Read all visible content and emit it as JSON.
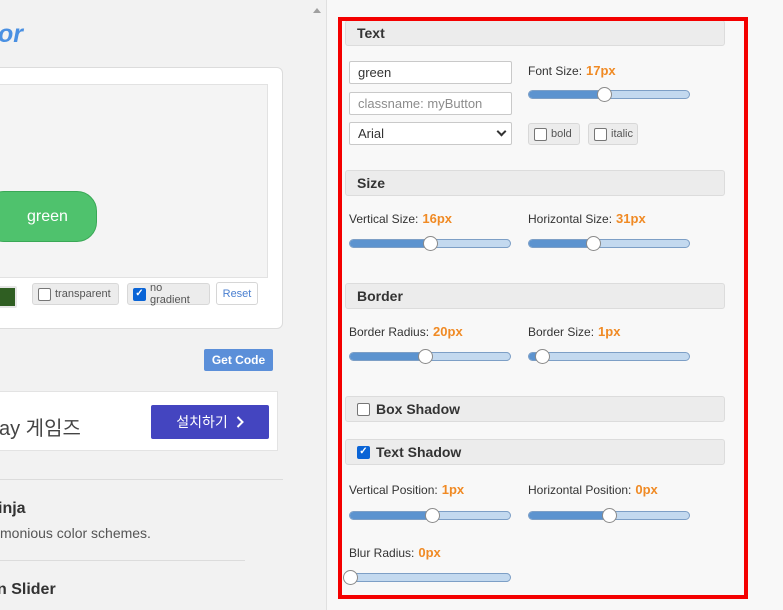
{
  "left": {
    "title": "or",
    "preview_text": "green",
    "swatch_color": "#2f5e22",
    "transparent_label": "transparent",
    "transparent_checked": false,
    "no_gradient_label": "no gradient",
    "no_gradient_checked": true,
    "reset_label": "Reset",
    "get_code_label": "Get Code",
    "ad_text": "ay 게임즈",
    "ad_button_label": "설치하기",
    "link1_title": "inja",
    "link1_desc": "monious color schemes.",
    "link2_title": "n Slider"
  },
  "text_section": {
    "title": "Text",
    "text_value": "green",
    "classname_placeholder": "classname: myButton",
    "font_family": "Arial",
    "font_size_label": "Font Size:",
    "font_size_value": "17px",
    "font_size_fraction": 0.47,
    "bold_label": "bold",
    "bold_checked": false,
    "italic_label": "italic",
    "italic_checked": false
  },
  "size_section": {
    "title": "Size",
    "vertical_label": "Vertical Size:",
    "vertical_value": "16px",
    "vertical_fraction": 0.5,
    "horizontal_label": "Horizontal Size:",
    "horizontal_value": "31px",
    "horizontal_fraction": 0.4
  },
  "border_section": {
    "title": "Border",
    "radius_label": "Border Radius:",
    "radius_value": "20px",
    "radius_fraction": 0.47,
    "size_label": "Border Size:",
    "size_value": "1px",
    "size_fraction": 0.08
  },
  "box_shadow_section": {
    "title": "Box Shadow",
    "checked": false
  },
  "text_shadow_section": {
    "title": "Text Shadow",
    "checked": true,
    "vpos_label": "Vertical Position:",
    "vpos_value": "1px",
    "vpos_fraction": 0.51,
    "hpos_label": "Horizontal Position:",
    "hpos_value": "0px",
    "hpos_fraction": 0.5,
    "blur_label": "Blur Radius:",
    "blur_value": "0px",
    "blur_fraction": 0.0
  },
  "colors": {
    "accent_value": "#f08a24",
    "highlight_border": "#f40000",
    "slider_fill": "#5c93cf"
  }
}
